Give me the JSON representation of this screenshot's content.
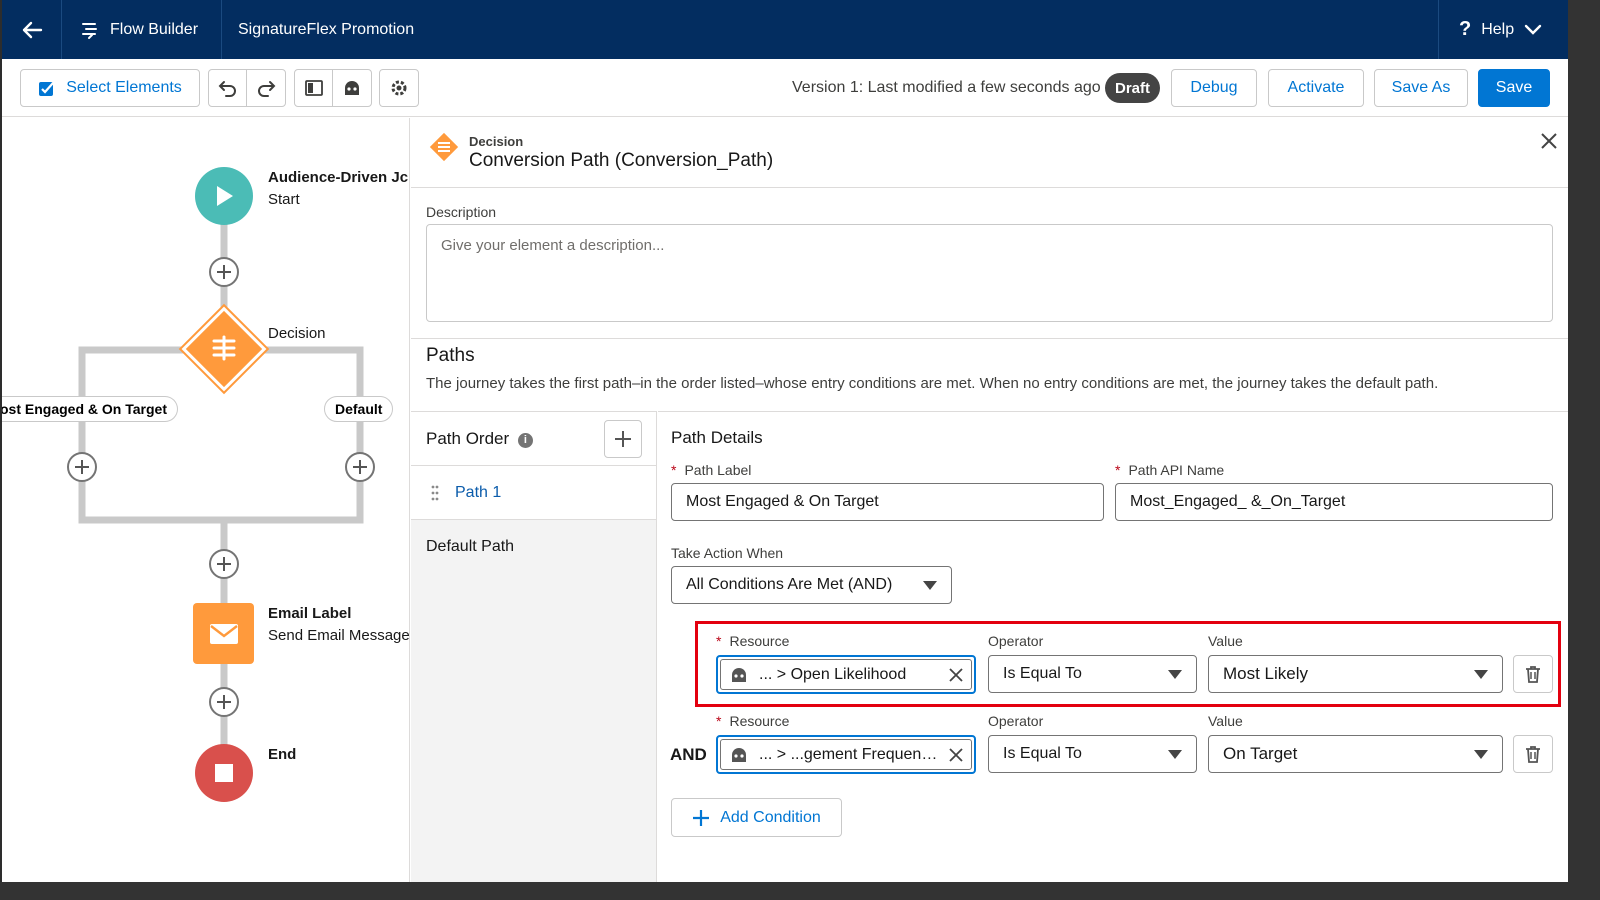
{
  "header": {
    "app_name": "Flow Builder",
    "flow_name": "SignatureFlex Promotion",
    "help_label": "Help"
  },
  "toolbar": {
    "select_elements": "Select Elements",
    "version_text": "Version 1: Last modified a few seconds ago",
    "status_badge": "Draft",
    "debug": "Debug",
    "activate": "Activate",
    "save_as": "Save As",
    "save": "Save"
  },
  "canvas": {
    "start_title": "Audience-Driven Jc",
    "start_sub": "Start",
    "decision_label": "Decision",
    "branch_left": "ost Engaged & On Target",
    "branch_right": "Default",
    "email_title": "Email Label",
    "email_sub": "Send Email Message",
    "end_title": "End"
  },
  "panel": {
    "element_type": "Decision",
    "element_title": "Conversion Path (Conversion_Path)",
    "description_label": "Description",
    "description_placeholder": "Give your element a description...",
    "paths_title": "Paths",
    "paths_description": "The journey takes the first path–in the order listed–whose entry conditions are met. When no entry conditions are met, the journey takes the default path.",
    "path_order_title": "Path Order",
    "paths": [
      "Path 1"
    ],
    "default_path": "Default Path",
    "details_title": "Path Details",
    "path_label_label": "Path Label",
    "path_label_value": "Most Engaged & On Target",
    "path_api_label": "Path API Name",
    "path_api_value": "Most_Engaged_ &_On_Target",
    "take_action_label": "Take Action When",
    "take_action_value": "All Conditions Are Met (AND)",
    "resource_label": "Resource",
    "operator_label": "Operator",
    "value_label": "Value",
    "conditions": [
      {
        "resource": "... > Open Likelihood",
        "operator": "Is Equal To",
        "value": "Most Likely"
      },
      {
        "resource": "... > ...gement Frequency...",
        "operator": "Is Equal To",
        "value": "On Target"
      }
    ],
    "and_label": "AND",
    "add_condition": "Add Condition"
  },
  "colors": {
    "header_bg": "#032d60",
    "brand_blue": "#0176d3",
    "start_teal": "#4bbcb6",
    "decision_orange": "#ff9a3c",
    "end_red": "#d9504c",
    "highlight_red": "#e3000f"
  }
}
